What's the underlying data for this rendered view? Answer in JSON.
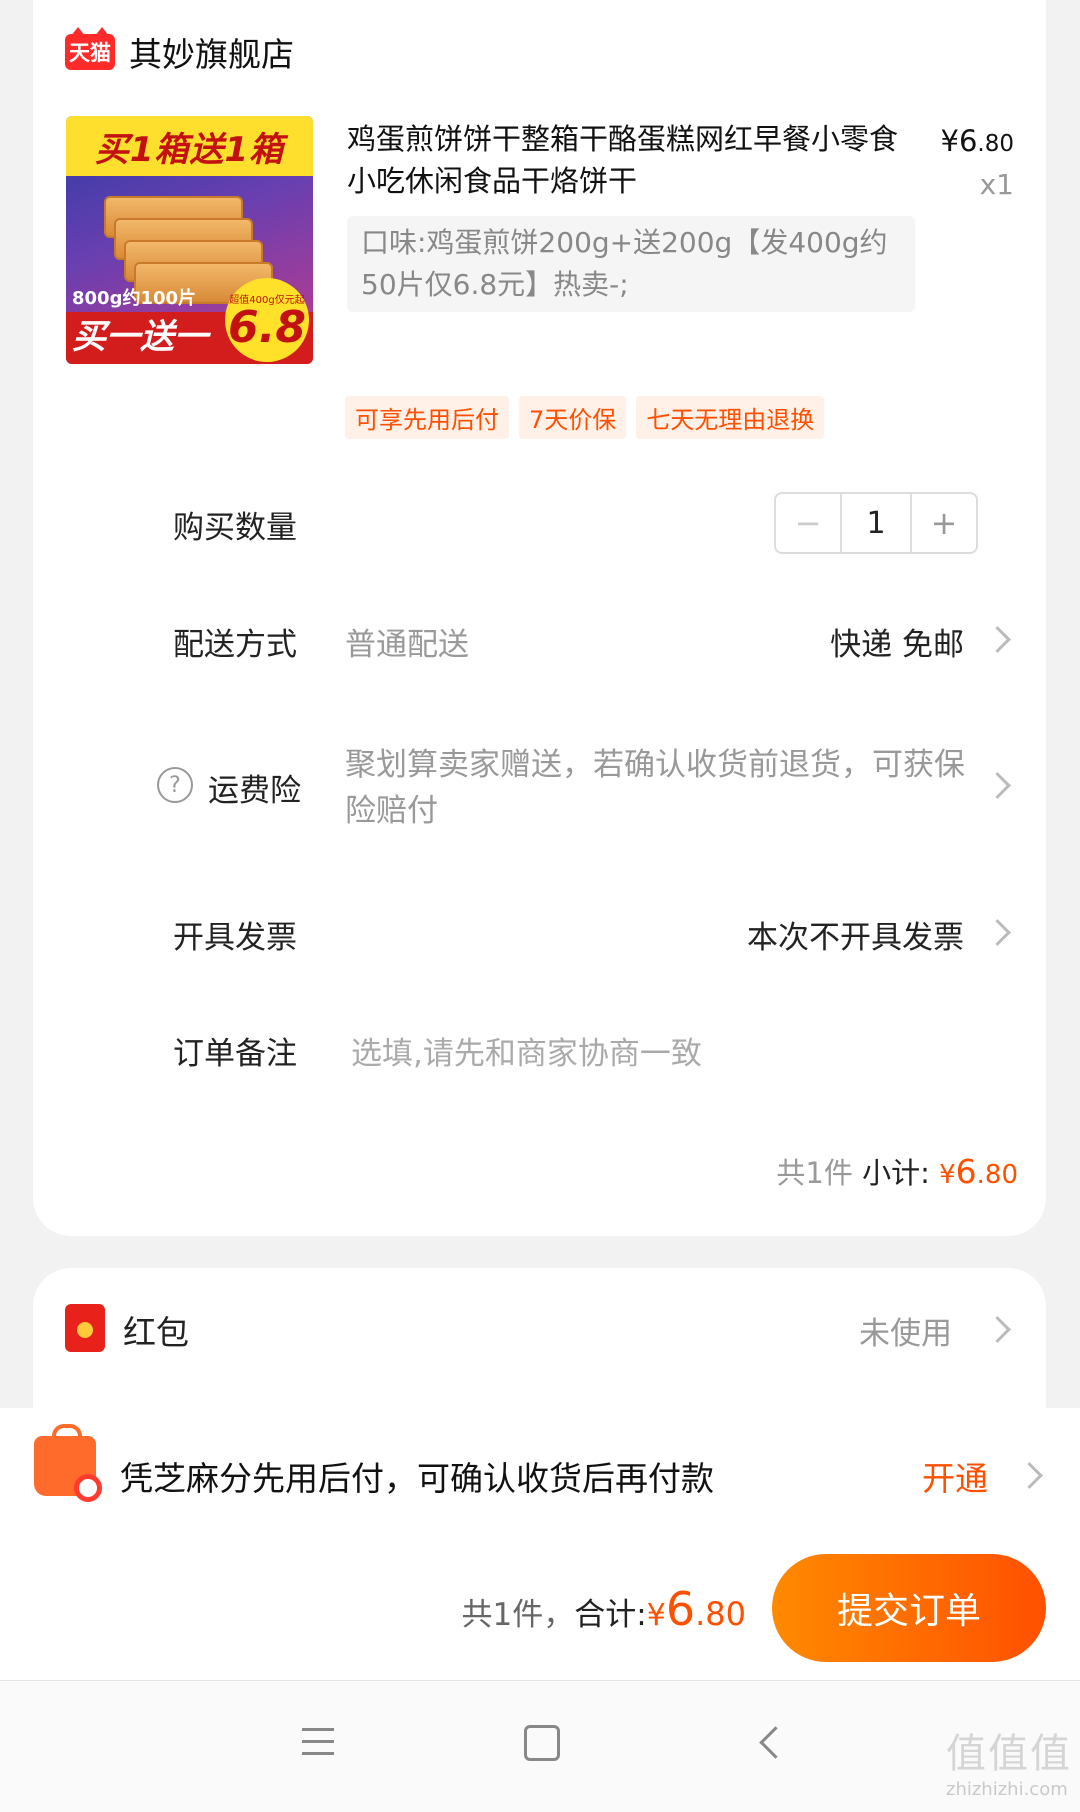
{
  "shop": {
    "badge": "天猫",
    "name": "其妙旗舰店"
  },
  "product": {
    "image_banner": "买1箱送1箱",
    "image_pcs": "800g约100片",
    "image_promo": "买一送一",
    "image_price_note": "超值400g仅元起",
    "image_price": "6.8",
    "title": "鸡蛋煎饼饼干整箱干酪蛋糕网红早餐小零食小吃休闲食品干烙饼干",
    "price_symbol": "¥",
    "price_int": "6",
    "price_dec": ".80",
    "quantity_x": "x1",
    "spec": "口味:鸡蛋煎饼200g+送200g【发400g约50片仅6.8元】热卖-;"
  },
  "tags": [
    "可享先用后付",
    "7天价保",
    "七天无理由退换"
  ],
  "quantity": {
    "label": "购买数量",
    "minus": "−",
    "value": "1",
    "plus": "+"
  },
  "delivery": {
    "label": "配送方式",
    "type": "普通配送",
    "value": "快递 免邮"
  },
  "shipping_insurance": {
    "help_icon": "?",
    "label": "运费险",
    "value": "聚划算卖家赠送，若确认收货前退货，可获保险赔付"
  },
  "invoice": {
    "label": "开具发票",
    "value": "本次不开具发票"
  },
  "remark": {
    "label": "订单备注",
    "placeholder": "选填,请先和商家协商一致"
  },
  "subtotal": {
    "count": "共1件",
    "label": "小计:",
    "symbol": "¥",
    "int": "6",
    "dec": ".80"
  },
  "red_packet": {
    "label": "红包",
    "value": "未使用"
  },
  "credit_pay": {
    "text": "凭芝麻分先用后付，可确认收货后再付款",
    "action": "开通"
  },
  "total": {
    "count": "共1件，",
    "label": "合计:",
    "symbol": "¥",
    "int": "6",
    "dec": ".80"
  },
  "submit_label": "提交订单",
  "watermark": {
    "big": "值值值",
    "small": "zhizhizhi.com"
  },
  "colors": {
    "accent": "#ff5000",
    "tag_bg": "#fff0e8",
    "tmall_red": "#ff2b2b"
  }
}
